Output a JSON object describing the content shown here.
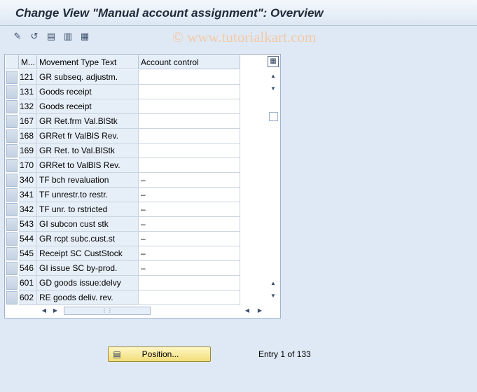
{
  "window": {
    "title": "Change View \"Manual account assignment\": Overview"
  },
  "watermark": "© www.tutorialkart.com",
  "toolbar": {
    "icons": [
      "edit-icon",
      "undo-icon",
      "table-icon",
      "copy-icon",
      "list-icon"
    ],
    "glyphs": [
      "✎",
      "↺",
      "▤",
      "▥",
      "▦"
    ]
  },
  "table": {
    "columns": [
      "M...",
      "Movement Type Text",
      "Account control"
    ],
    "rows": [
      {
        "mvt": "121",
        "text": "GR subseq. adjustm.",
        "acc": ""
      },
      {
        "mvt": "131",
        "text": "Goods receipt",
        "acc": ""
      },
      {
        "mvt": "132",
        "text": "Goods receipt",
        "acc": ""
      },
      {
        "mvt": "167",
        "text": "GR Ret.frm Val.BlStk",
        "acc": ""
      },
      {
        "mvt": "168",
        "text": "GRRet fr ValBlS Rev.",
        "acc": ""
      },
      {
        "mvt": "169",
        "text": "GR Ret. to Val.BlStk",
        "acc": ""
      },
      {
        "mvt": "170",
        "text": "GRRet to ValBlS Rev.",
        "acc": ""
      },
      {
        "mvt": "340",
        "text": "TF bch revaluation",
        "acc": "–"
      },
      {
        "mvt": "341",
        "text": "TF unrestr.to restr.",
        "acc": "–"
      },
      {
        "mvt": "342",
        "text": "TF unr. to rstricted",
        "acc": "–"
      },
      {
        "mvt": "543",
        "text": "GI subcon cust stk",
        "acc": "–"
      },
      {
        "mvt": "544",
        "text": "GR rcpt subc.cust.st",
        "acc": "–"
      },
      {
        "mvt": "545",
        "text": "Receipt SC CustStock",
        "acc": "–"
      },
      {
        "mvt": "546",
        "text": "GI issue SC by-prod.",
        "acc": "–"
      },
      {
        "mvt": "601",
        "text": "GD goods issue:delvy",
        "acc": ""
      },
      {
        "mvt": "602",
        "text": "RE goods deliv. rev.",
        "acc": ""
      }
    ]
  },
  "position_button": {
    "label": "Position..."
  },
  "entry_info": "Entry 1 of 133"
}
